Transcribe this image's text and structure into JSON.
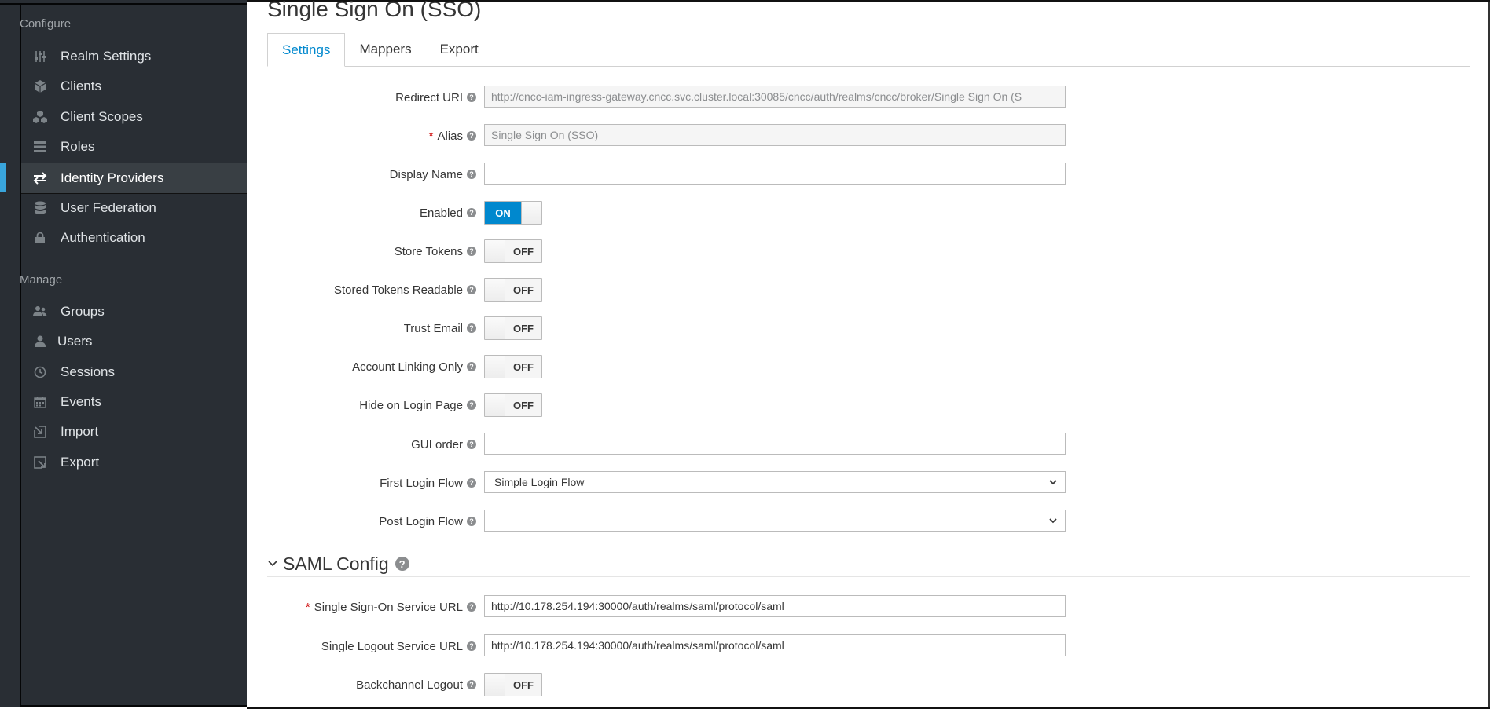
{
  "sidebar": {
    "configure_label": "Configure",
    "configure_items": [
      {
        "label": "Realm Settings",
        "icon": "sliders-icon"
      },
      {
        "label": "Clients",
        "icon": "cube-icon"
      },
      {
        "label": "Client Scopes",
        "icon": "cubes-icon"
      },
      {
        "label": "Roles",
        "icon": "list-icon"
      },
      {
        "label": "Identity Providers",
        "icon": "exchange-icon",
        "active": true
      },
      {
        "label": "User Federation",
        "icon": "database-icon"
      },
      {
        "label": "Authentication",
        "icon": "lock-icon"
      }
    ],
    "manage_label": "Manage",
    "manage_items": [
      {
        "label": "Groups",
        "icon": "users-icon"
      },
      {
        "label": "Users",
        "icon": "user-icon"
      },
      {
        "label": "Sessions",
        "icon": "clock-icon"
      },
      {
        "label": "Events",
        "icon": "calendar-icon"
      },
      {
        "label": "Import",
        "icon": "import-icon"
      },
      {
        "label": "Export",
        "icon": "export-icon"
      }
    ]
  },
  "page": {
    "title": "Single Sign On (SSO)",
    "tabs": [
      "Settings",
      "Mappers",
      "Export"
    ]
  },
  "form": {
    "redirect_uri": {
      "label": "Redirect URI",
      "value": "http://cncc-iam-ingress-gateway.cncc.svc.cluster.local:30085/cncc/auth/realms/cncc/broker/Single Sign On (S"
    },
    "alias": {
      "label": "Alias",
      "value": "Single Sign On (SSO)"
    },
    "display_name": {
      "label": "Display Name",
      "value": ""
    },
    "enabled": {
      "label": "Enabled",
      "state": "ON"
    },
    "store_tokens": {
      "label": "Store Tokens",
      "state": "OFF"
    },
    "stored_tokens_readable": {
      "label": "Stored Tokens Readable",
      "state": "OFF"
    },
    "trust_email": {
      "label": "Trust Email",
      "state": "OFF"
    },
    "account_linking_only": {
      "label": "Account Linking Only",
      "state": "OFF"
    },
    "hide_on_login_page": {
      "label": "Hide on Login Page",
      "state": "OFF"
    },
    "gui_order": {
      "label": "GUI order",
      "value": ""
    },
    "first_login_flow": {
      "label": "First Login Flow",
      "value": "Simple Login Flow"
    },
    "post_login_flow": {
      "label": "Post Login Flow",
      "value": ""
    }
  },
  "saml": {
    "header": "SAML Config",
    "sso_url": {
      "label": "Single Sign-On Service URL",
      "value": "http://10.178.254.194:30000/auth/realms/saml/protocol/saml"
    },
    "slo_url": {
      "label": "Single Logout Service URL",
      "value": "http://10.178.254.194:30000/auth/realms/saml/protocol/saml"
    },
    "backchannel_logout": {
      "label": "Backchannel Logout",
      "state": "OFF"
    }
  },
  "colors": {
    "sidebar_bg": "#292e34",
    "accent": "#0088ce",
    "active_bar": "#39a5dc"
  }
}
